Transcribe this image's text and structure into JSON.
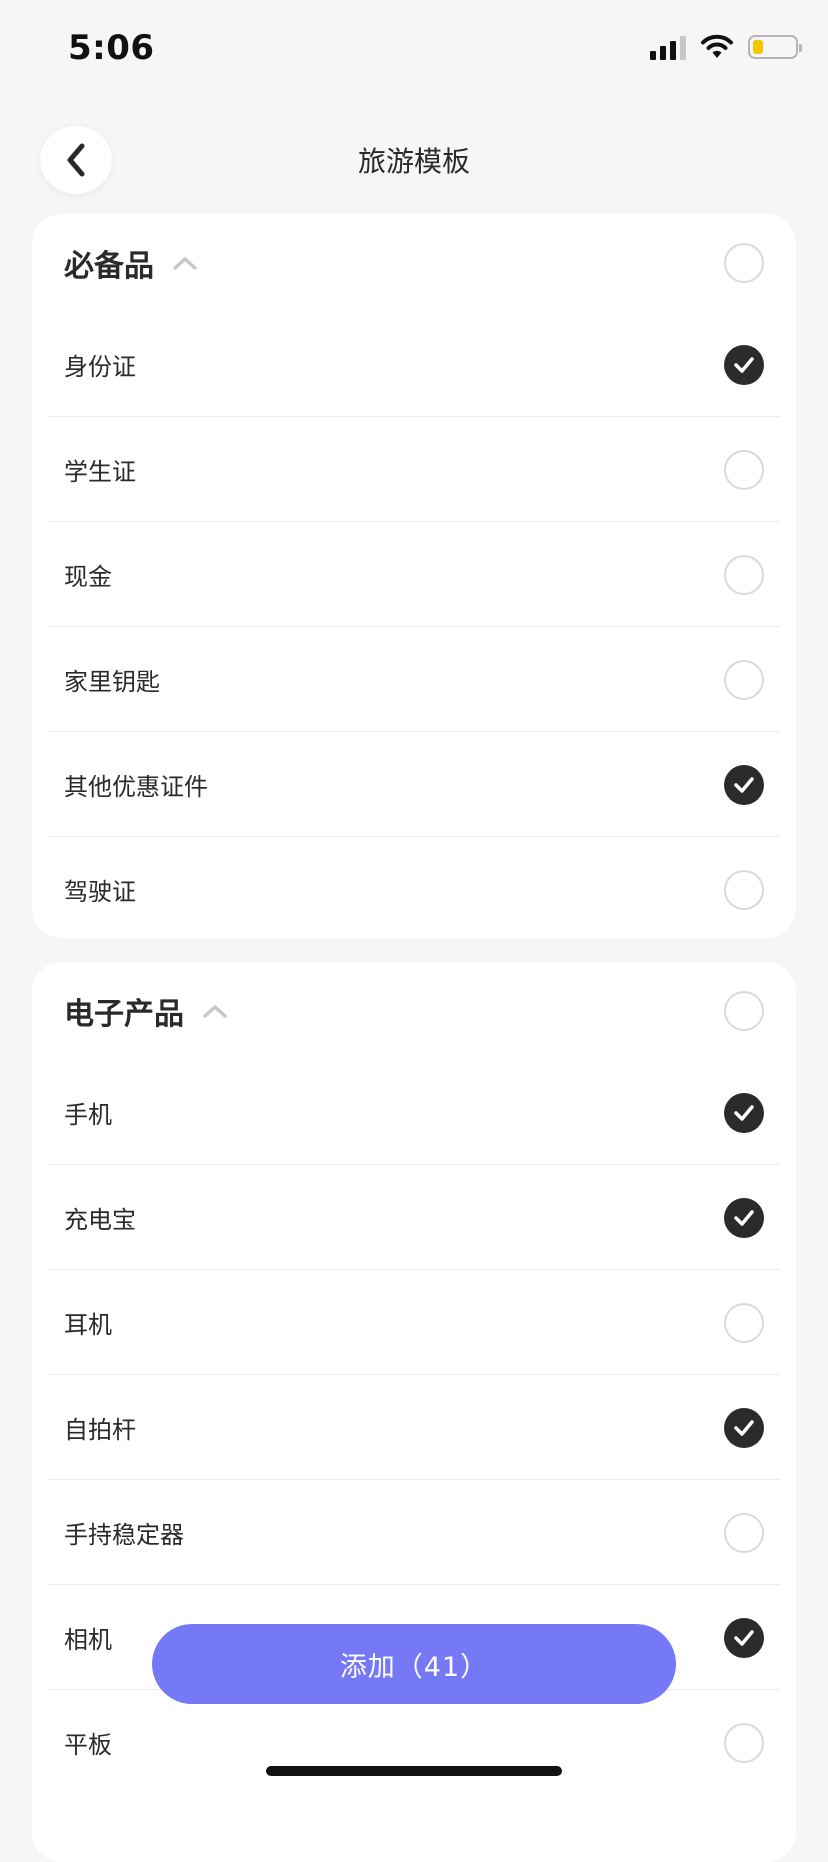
{
  "status_bar": {
    "time": "5:06",
    "battery_level": 0.25,
    "battery_color": "#f7c400"
  },
  "header": {
    "title": "旅游模板",
    "back_icon": "chevron-left-icon"
  },
  "sections": [
    {
      "title": "必备品",
      "expanded": true,
      "all_checked": false,
      "items": [
        {
          "label": "身份证",
          "checked": true
        },
        {
          "label": "学生证",
          "checked": false
        },
        {
          "label": "现金",
          "checked": false
        },
        {
          "label": "家里钥匙",
          "checked": false
        },
        {
          "label": "其他优惠证件",
          "checked": true
        },
        {
          "label": "驾驶证",
          "checked": false
        }
      ]
    },
    {
      "title": "电子产品",
      "expanded": true,
      "all_checked": false,
      "items": [
        {
          "label": "手机",
          "checked": true
        },
        {
          "label": "充电宝",
          "checked": true
        },
        {
          "label": "耳机",
          "checked": false
        },
        {
          "label": "自拍杆",
          "checked": true
        },
        {
          "label": "手持稳定器",
          "checked": false
        },
        {
          "label": "相机",
          "checked": true
        },
        {
          "label": "平板",
          "checked": false
        }
      ]
    }
  ],
  "add_button": {
    "label": "添加（41）",
    "color": "#7579f6"
  }
}
